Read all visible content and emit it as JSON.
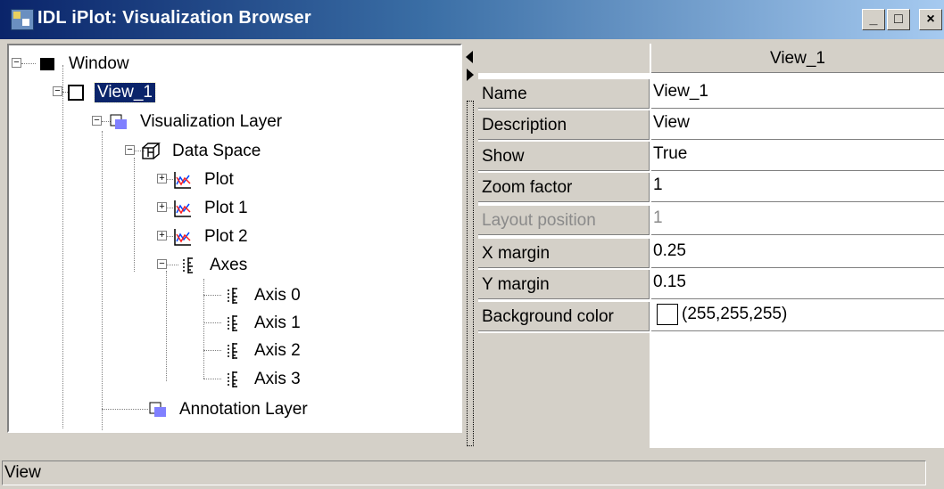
{
  "window": {
    "title": "IDL iPlot: Visualization Browser"
  },
  "title_buttons": {
    "minimize": "_",
    "maximize": "□",
    "close": "×"
  },
  "tree": {
    "nodes": [
      {
        "label": "Window"
      },
      {
        "label": "View_1",
        "selected": true
      },
      {
        "label": "Visualization Layer"
      },
      {
        "label": "Data Space"
      },
      {
        "label": "Plot"
      },
      {
        "label": "Plot 1"
      },
      {
        "label": "Plot 2"
      },
      {
        "label": "Axes"
      },
      {
        "label": "Axis 0"
      },
      {
        "label": "Axis 1"
      },
      {
        "label": "Axis 2"
      },
      {
        "label": "Axis 3"
      },
      {
        "label": "Annotation Layer"
      }
    ]
  },
  "properties": {
    "column_header": "View_1",
    "rows": [
      {
        "name": "Name",
        "value": "View_1"
      },
      {
        "name": "Description",
        "value": "View"
      },
      {
        "name": "Show",
        "value": "True"
      },
      {
        "name": "Zoom factor",
        "value": "1"
      },
      {
        "name": "Layout position",
        "value": "1",
        "disabled": true
      },
      {
        "name": "X margin",
        "value": "0.25"
      },
      {
        "name": "Y margin",
        "value": "0.15"
      },
      {
        "name": "Background color",
        "value": "(255,255,255)"
      }
    ]
  },
  "status": {
    "text": "View"
  },
  "colors": {
    "title_gradient_start": "#0a246a",
    "title_gradient_end": "#a6caf0",
    "selection": "#0a246a",
    "face": "#d4d0c8"
  }
}
